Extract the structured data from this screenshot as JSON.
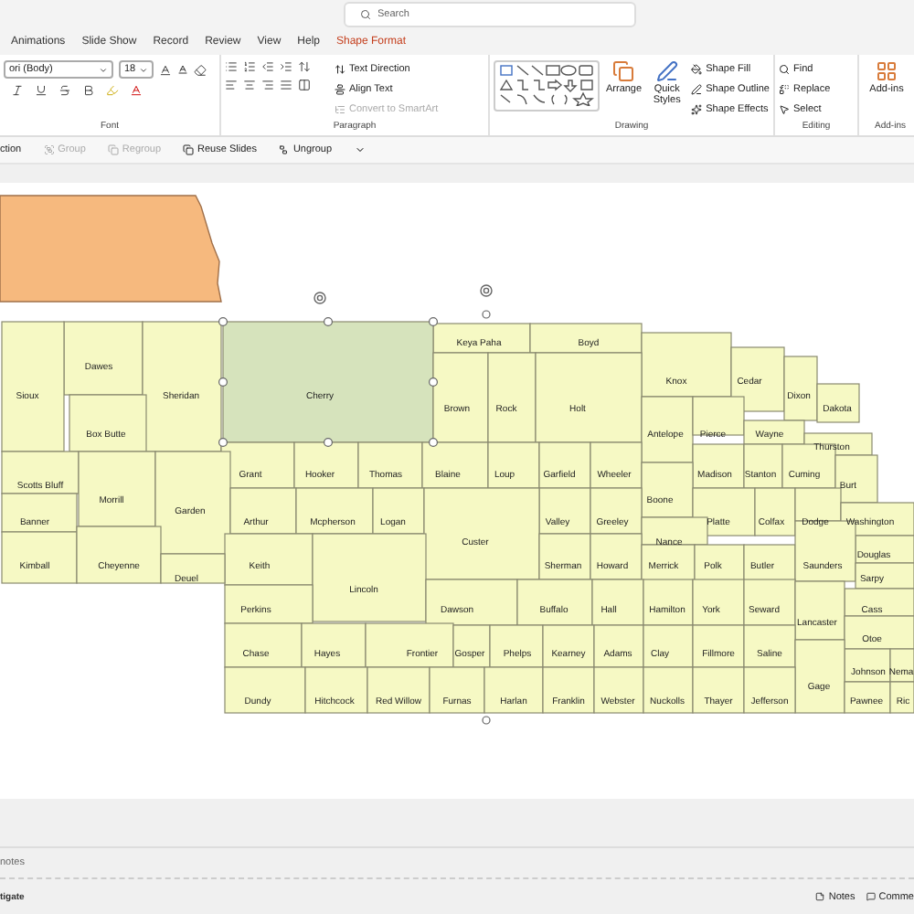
{
  "search": {
    "placeholder": "Search"
  },
  "tabs": [
    {
      "label": "Animations",
      "selected": false
    },
    {
      "label": "Slide Show",
      "selected": false
    },
    {
      "label": "Record",
      "selected": false
    },
    {
      "label": "Review",
      "selected": false
    },
    {
      "label": "View",
      "selected": false
    },
    {
      "label": "Help",
      "selected": false
    },
    {
      "label": "Shape Format",
      "selected": true
    }
  ],
  "font": {
    "name": "ori (Body)",
    "size": "18"
  },
  "paragraph_commands": [
    {
      "label": "Text Direction",
      "disabled": false
    },
    {
      "label": "Align Text",
      "disabled": false
    },
    {
      "label": "Convert to SmartArt",
      "disabled": true
    }
  ],
  "drawing": {
    "arrange": "Arrange",
    "quick_styles": "Quick Styles",
    "commands": [
      "Shape Fill",
      "Shape Outline",
      "Shape Effects"
    ]
  },
  "editing": [
    "Find",
    "Replace",
    "Select"
  ],
  "addins": "Add-ins",
  "group_labels": [
    "Font",
    "Paragraph",
    "Drawing",
    "Editing",
    "Add-ins"
  ],
  "quick_access": [
    {
      "label": "ction",
      "disabled": false
    },
    {
      "label": "Group",
      "disabled": true
    },
    {
      "label": "Regroup",
      "disabled": true
    },
    {
      "label": "Reuse Slides",
      "disabled": false
    },
    {
      "label": "Ungroup",
      "disabled": false
    }
  ],
  "counties": [
    {
      "name": "Keya Paha",
      "selected": false
    },
    {
      "name": "Boyd",
      "selected": false
    },
    {
      "name": "Dawes",
      "selected": false
    },
    {
      "name": "Knox",
      "selected": false
    },
    {
      "name": "Cedar",
      "selected": false
    },
    {
      "name": "Sioux",
      "selected": false
    },
    {
      "name": "Sheridan",
      "selected": false
    },
    {
      "name": "Cherry",
      "selected": true
    },
    {
      "name": "Dixon",
      "selected": false
    },
    {
      "name": "Brown",
      "selected": false
    },
    {
      "name": "Rock",
      "selected": false
    },
    {
      "name": "Holt",
      "selected": false
    },
    {
      "name": "Dakota",
      "selected": false
    },
    {
      "name": "Box Butte",
      "selected": false
    },
    {
      "name": "Antelope",
      "selected": false
    },
    {
      "name": "Pierce",
      "selected": false
    },
    {
      "name": "Wayne",
      "selected": false
    },
    {
      "name": "Thurston",
      "selected": false
    },
    {
      "name": "Grant",
      "selected": false
    },
    {
      "name": "Hooker",
      "selected": false
    },
    {
      "name": "Thomas",
      "selected": false
    },
    {
      "name": "Blaine",
      "selected": false
    },
    {
      "name": "Loup",
      "selected": false
    },
    {
      "name": "Garfield",
      "selected": false
    },
    {
      "name": "Wheeler",
      "selected": false
    },
    {
      "name": "Madison",
      "selected": false
    },
    {
      "name": "Stanton",
      "selected": false
    },
    {
      "name": "Cuming",
      "selected": false
    },
    {
      "name": "Scotts Bluff",
      "selected": false
    },
    {
      "name": "Burt",
      "selected": false
    },
    {
      "name": "Morrill",
      "selected": false
    },
    {
      "name": "Boone",
      "selected": false
    },
    {
      "name": "Garden",
      "selected": false
    },
    {
      "name": "Banner",
      "selected": false
    },
    {
      "name": "Arthur",
      "selected": false
    },
    {
      "name": "Mcpherson",
      "selected": false
    },
    {
      "name": "Logan",
      "selected": false
    },
    {
      "name": "Valley",
      "selected": false
    },
    {
      "name": "Greeley",
      "selected": false
    },
    {
      "name": "Platte",
      "selected": false
    },
    {
      "name": "Colfax",
      "selected": false
    },
    {
      "name": "Dodge",
      "selected": false
    },
    {
      "name": "Washington",
      "selected": false
    },
    {
      "name": "Custer",
      "selected": false
    },
    {
      "name": "Nance",
      "selected": false
    },
    {
      "name": "Douglas",
      "selected": false
    },
    {
      "name": "Kimball",
      "selected": false
    },
    {
      "name": "Cheyenne",
      "selected": false
    },
    {
      "name": "Keith",
      "selected": false
    },
    {
      "name": "Sherman",
      "selected": false
    },
    {
      "name": "Howard",
      "selected": false
    },
    {
      "name": "Merrick",
      "selected": false
    },
    {
      "name": "Polk",
      "selected": false
    },
    {
      "name": "Butler",
      "selected": false
    },
    {
      "name": "Saunders",
      "selected": false
    },
    {
      "name": "Deuel",
      "selected": false
    },
    {
      "name": "Sarpy",
      "selected": false
    },
    {
      "name": "Lincoln",
      "selected": false
    },
    {
      "name": "Perkins",
      "selected": false
    },
    {
      "name": "Dawson",
      "selected": false
    },
    {
      "name": "Buffalo",
      "selected": false
    },
    {
      "name": "Hall",
      "selected": false
    },
    {
      "name": "Hamilton",
      "selected": false
    },
    {
      "name": "York",
      "selected": false
    },
    {
      "name": "Seward",
      "selected": false
    },
    {
      "name": "Cass",
      "selected": false
    },
    {
      "name": "Lancaster",
      "selected": false
    },
    {
      "name": "Otoe",
      "selected": false
    },
    {
      "name": "Chase",
      "selected": false
    },
    {
      "name": "Hayes",
      "selected": false
    },
    {
      "name": "Frontier",
      "selected": false
    },
    {
      "name": "Gosper",
      "selected": false
    },
    {
      "name": "Phelps",
      "selected": false
    },
    {
      "name": "Kearney",
      "selected": false
    },
    {
      "name": "Adams",
      "selected": false
    },
    {
      "name": "Clay",
      "selected": false
    },
    {
      "name": "Fillmore",
      "selected": false
    },
    {
      "name": "Saline",
      "selected": false
    },
    {
      "name": "Johnson",
      "selected": false
    },
    {
      "name": "Nema",
      "selected": false
    },
    {
      "name": "Gage",
      "selected": false
    },
    {
      "name": "Dundy",
      "selected": false
    },
    {
      "name": "Hitchcock",
      "selected": false
    },
    {
      "name": "Red Willow",
      "selected": false
    },
    {
      "name": "Furnas",
      "selected": false
    },
    {
      "name": "Harlan",
      "selected": false
    },
    {
      "name": "Franklin",
      "selected": false
    },
    {
      "name": "Webster",
      "selected": false
    },
    {
      "name": "Nuckolls",
      "selected": false
    },
    {
      "name": "Thayer",
      "selected": false
    },
    {
      "name": "Jefferson",
      "selected": false
    },
    {
      "name": "Pawnee",
      "selected": false
    },
    {
      "name": "Ric",
      "selected": false
    }
  ],
  "notes": {
    "placeholder": "notes"
  },
  "status_bar": {
    "left": "tigate",
    "notes": "Notes",
    "comments": "Comme"
  }
}
